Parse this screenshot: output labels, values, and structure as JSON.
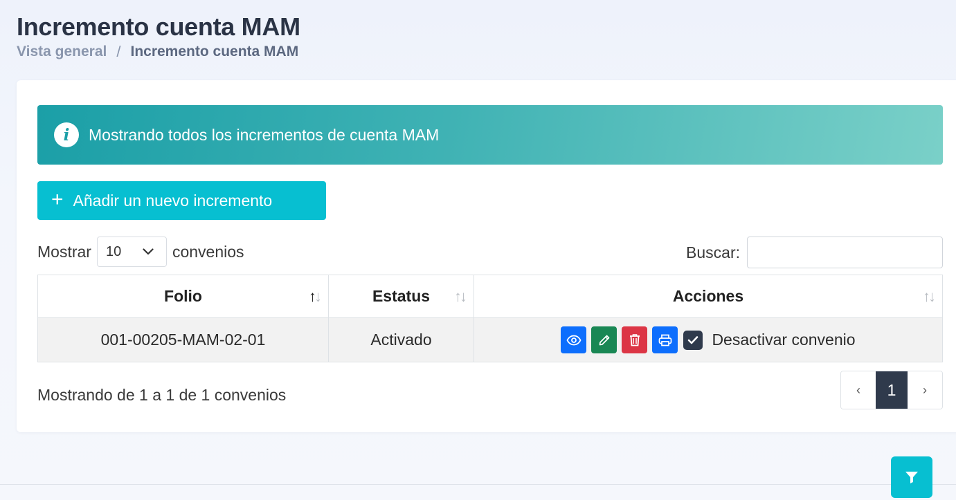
{
  "header": {
    "title": "Incremento cuenta MAM",
    "breadcrumb": {
      "root": "Vista general",
      "separator": "/",
      "current": "Incremento cuenta MAM"
    }
  },
  "alert": {
    "icon": "info-icon",
    "text": "Mostrando todos los incrementos de cuenta MAM"
  },
  "add_button": {
    "icon": "plus-icon",
    "label": "Añadir un nuevo incremento"
  },
  "table_controls": {
    "show_label": "Mostrar",
    "page_length": "10",
    "show_suffix": "convenios",
    "search_label": "Buscar:",
    "search_value": ""
  },
  "table": {
    "columns": [
      "Folio",
      "Estatus",
      "Acciones"
    ],
    "rows": [
      {
        "folio": "001-00205-MAM-02-01",
        "estatus": "Activado",
        "action_icons": [
          "eye-icon",
          "pencil-icon",
          "trash-icon",
          "printer-icon"
        ],
        "toggle_label": "Desactivar convenio"
      }
    ]
  },
  "footer": {
    "info": "Mostrando de 1 a 1 de 1 convenios",
    "pagination": {
      "prev": "‹",
      "current": "1",
      "next": "›"
    }
  },
  "floating": {
    "icon": "filter-icon"
  },
  "colors": {
    "accent": "#07bfd1",
    "dark": "#2f3a4c",
    "view": "#0d6efd",
    "edit": "#198754",
    "delete": "#dc3545"
  }
}
